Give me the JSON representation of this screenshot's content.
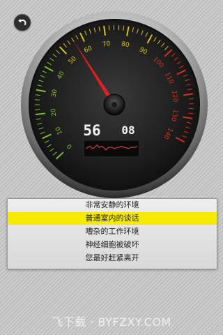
{
  "colors": {
    "accent_yellow": "#f6ea00",
    "needle_red": "#e02020",
    "scale_green": "#7fbf2f",
    "scale_yellow": "#d8c21a",
    "scale_red": "#d23020",
    "lcd_digit": "#f2f2f2",
    "graph_red": "#d33a3a"
  },
  "back_button": {
    "icon": "back-arrow-icon"
  },
  "gauge": {
    "value": 56,
    "scale_min": 0,
    "scale_max": 140,
    "ticks": [
      "0",
      "10",
      "20",
      "30",
      "40",
      "50",
      "60",
      "70",
      "80",
      "90",
      "100",
      "110",
      "120",
      "130",
      "140"
    ],
    "readout": {
      "current": "56",
      "secondary": "08"
    },
    "trend": [
      5,
      6,
      7,
      5,
      6,
      8,
      6,
      7,
      6,
      4,
      6,
      6,
      6,
      5,
      6,
      6,
      7,
      6,
      6,
      5,
      6,
      6,
      6,
      7
    ]
  },
  "menu": {
    "items": [
      {
        "label": "非常安静的环境"
      },
      {
        "label": "普通室内的谈话"
      },
      {
        "label": "嘈杂的工作环境"
      },
      {
        "label": "神经细胞被破坏"
      },
      {
        "label": "您最好赶紧离开"
      }
    ],
    "selected_index": 1
  },
  "watermark": "飞下载 · BYFZXY.COM"
}
